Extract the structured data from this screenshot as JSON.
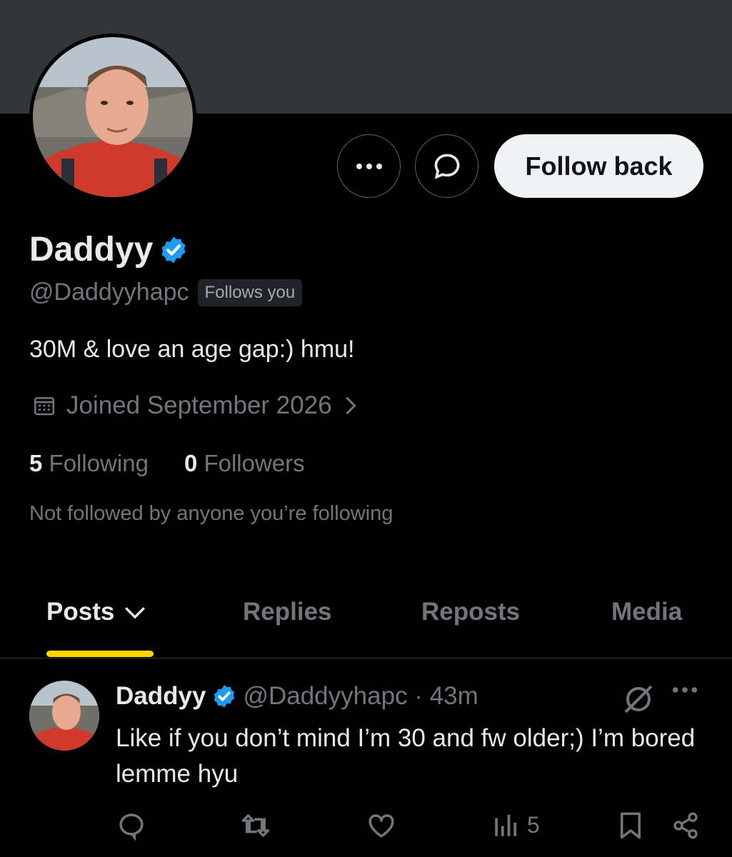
{
  "profile": {
    "display_name": "Daddyy",
    "handle": "@Daddyyhapc",
    "follows_you": "Follows you",
    "bio": "30M & love an age gap:) hmu!",
    "joined": "Joined September 2026",
    "following_count": "5",
    "following_label": "Following",
    "followers_count": "0",
    "followers_label": "Followers",
    "not_followed_text": "Not followed by anyone you’re following"
  },
  "actions": {
    "follow_back_label": "Follow back"
  },
  "tabs": [
    {
      "label": "Posts"
    },
    {
      "label": "Replies"
    },
    {
      "label": "Reposts"
    },
    {
      "label": "Media"
    }
  ],
  "post": {
    "display_name": "Daddyy",
    "meta": "@Daddyyhapc · 43m",
    "text": "Like if you don’t mind I’m 30 and fw older;) I’m bored lemme hyu",
    "views": "5"
  },
  "colors": {
    "background": "#000000",
    "banner": "#333639",
    "verified": "#1d9bf0",
    "tab_indicator": "#ffd400",
    "muted_text": "#71767b"
  },
  "icons": [
    "more-icon",
    "message-icon",
    "verified-badge-icon",
    "calendar-icon",
    "chevron-right-icon",
    "chevron-down-icon",
    "grok-icon",
    "reply-icon",
    "repost-icon",
    "like-icon",
    "views-icon",
    "bookmark-icon",
    "share-icon"
  ]
}
